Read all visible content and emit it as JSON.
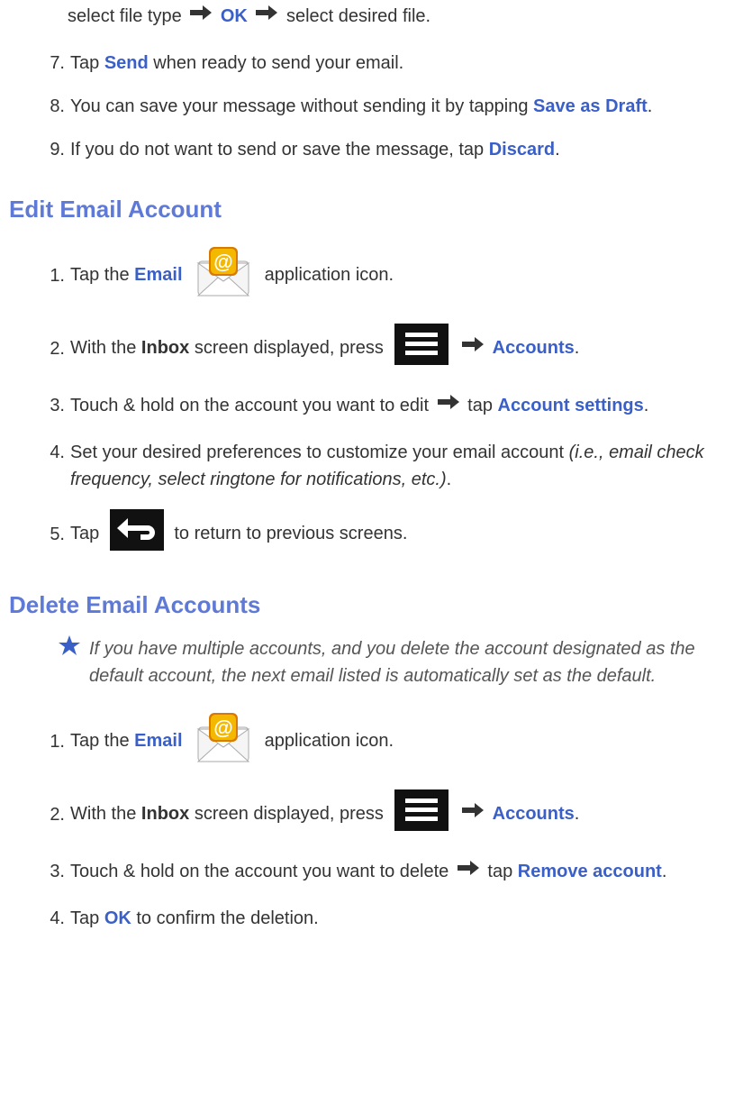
{
  "intro": {
    "line_a": "select file type ",
    "ok": "OK",
    "line_b": " select desired file."
  },
  "steps_top": {
    "s7": {
      "num": "7.",
      "a": "Tap ",
      "send": "Send",
      "b": " when ready to send your email."
    },
    "s8": {
      "num": "8.",
      "a": "You can save your message without sending it by tapping ",
      "save": "Save as Draft",
      "b": "."
    },
    "s9": {
      "num": "9.",
      "a": "If you do not want to send or save the message, tap ",
      "discard": "Discard",
      "b": "."
    }
  },
  "edit": {
    "heading": "Edit Email Account",
    "s1": {
      "num": "1.",
      "a": "Tap the ",
      "email": "Email",
      "b": " application icon."
    },
    "s2": {
      "num": "2.",
      "a": "With the ",
      "inbox": "Inbox",
      "b": " screen displayed, press ",
      "accounts": "Accounts",
      "c": "."
    },
    "s3": {
      "num": "3.",
      "a": "Touch & hold on the account you want to edit ",
      "tap": " tap ",
      "acct": "Account settings",
      "b": "."
    },
    "s4": {
      "num": "4.",
      "a": "Set your desired preferences to customize your email account ",
      "ital": "(i.e., email check frequency, select ringtone for notifications, etc.)",
      "b": "."
    },
    "s5": {
      "num": "5.",
      "a": "Tap ",
      "b": " to return to previous screens."
    }
  },
  "del": {
    "heading": "Delete Email Accounts",
    "note": "If you have multiple accounts, and you delete the account designated as the default account, the next email listed is automatically set as the default.",
    "s1": {
      "num": "1.",
      "a": "Tap the ",
      "email": "Email",
      "b": " application icon."
    },
    "s2": {
      "num": "2.",
      "a": "With the ",
      "inbox": "Inbox",
      "b": " screen displayed, press ",
      "accounts": "Accounts",
      "c": "."
    },
    "s3": {
      "num": "3.",
      "a": "Touch & hold on the account you want to delete ",
      "tap": " tap ",
      "remove": "Remove account",
      "b": "."
    },
    "s4": {
      "num": "4.",
      "a": "Tap ",
      "ok": "OK",
      "b": " to confirm the deletion."
    }
  }
}
